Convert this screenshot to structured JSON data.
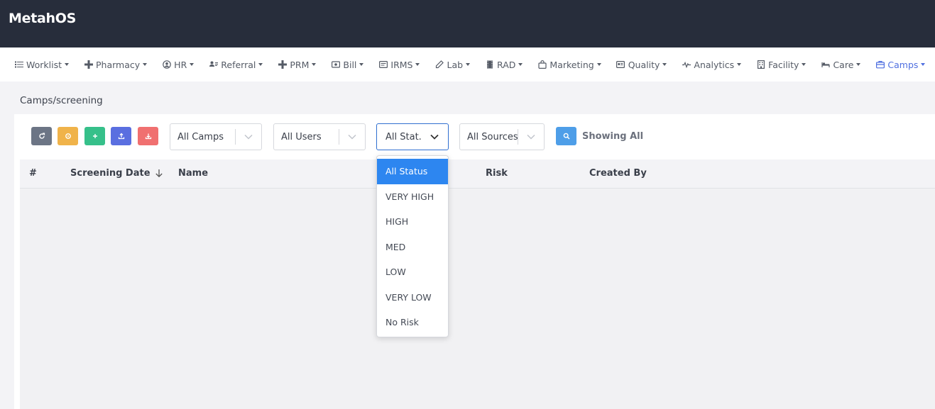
{
  "app": {
    "brand": "MetahOS"
  },
  "nav": {
    "items": [
      {
        "label": "Worklist",
        "icon": "list-icon"
      },
      {
        "label": "Pharmacy",
        "icon": "plus-icon"
      },
      {
        "label": "HR",
        "icon": "user-circle-icon"
      },
      {
        "label": "Referral",
        "icon": "users-icon"
      },
      {
        "label": "PRM",
        "icon": "plus-icon"
      },
      {
        "label": "Bill",
        "icon": "bill-icon"
      },
      {
        "label": "IRMS",
        "icon": "card-icon"
      },
      {
        "label": "Lab",
        "icon": "pencil-icon"
      },
      {
        "label": "RAD",
        "icon": "film-icon"
      },
      {
        "label": "Marketing",
        "icon": "bag-icon"
      },
      {
        "label": "Quality",
        "icon": "id-card-icon"
      },
      {
        "label": "Analytics",
        "icon": "pulse-icon"
      },
      {
        "label": "Facility",
        "icon": "building-icon"
      },
      {
        "label": "Care",
        "icon": "bed-icon"
      },
      {
        "label": "Camps",
        "icon": "briefcase-icon",
        "active": true
      }
    ]
  },
  "page": {
    "breadcrumb": "Camps/screening"
  },
  "toolbar": {
    "buttons": [
      {
        "name": "refresh-button",
        "icon": "refresh-icon",
        "color": "#6c7585"
      },
      {
        "name": "settings-button",
        "icon": "gear-icon",
        "color": "#f0b34a"
      },
      {
        "name": "add-button",
        "icon": "plus-icon",
        "color": "#36c08a"
      },
      {
        "name": "upload-button",
        "icon": "upload-icon",
        "color": "#5a6fe0"
      },
      {
        "name": "download-button",
        "icon": "download-icon",
        "color": "#f07070"
      }
    ],
    "filters": {
      "camps": "All Camps",
      "users": "All Users",
      "status": "All Stat...",
      "sources": "All Sources"
    },
    "showing": "Showing All"
  },
  "table": {
    "columns": [
      "#",
      "Screening Date",
      "Name",
      "Risk",
      "Created By"
    ]
  },
  "status_dropdown": {
    "options": [
      "All Status",
      "VERY HIGH",
      "HIGH",
      "MED",
      "LOW",
      "VERY LOW",
      "No Risk"
    ],
    "selected": "All Status"
  },
  "colors": {
    "topbar": "#272d3b",
    "accent": "#4f6fe0",
    "selected_option": "#2d86f0",
    "search_button": "#4e9ee8"
  }
}
